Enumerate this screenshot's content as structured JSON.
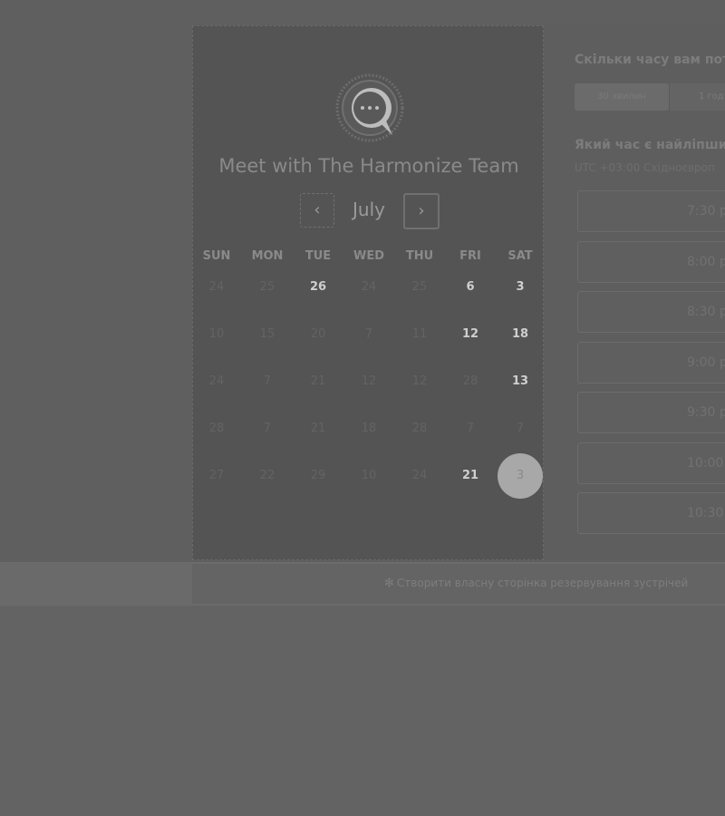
{
  "calendar": {
    "title": "Meet with The Harmonize Team",
    "month": "July",
    "prev_label": "‹",
    "next_label": "›",
    "weekdays": [
      "SUN",
      "MON",
      "TUE",
      "WED",
      "THU",
      "FRI",
      "SAT"
    ],
    "weeks": [
      [
        {
          "d": "24",
          "a": false
        },
        {
          "d": "25",
          "a": false
        },
        {
          "d": "26",
          "a": true
        },
        {
          "d": "24",
          "a": false
        },
        {
          "d": "25",
          "a": false
        },
        {
          "d": "6",
          "a": true
        },
        {
          "d": "3",
          "a": true
        }
      ],
      [
        {
          "d": "10",
          "a": false
        },
        {
          "d": "15",
          "a": false
        },
        {
          "d": "20",
          "a": false
        },
        {
          "d": "7",
          "a": false
        },
        {
          "d": "11",
          "a": false
        },
        {
          "d": "12",
          "a": true
        },
        {
          "d": "18",
          "a": true
        }
      ],
      [
        {
          "d": "24",
          "a": false
        },
        {
          "d": "7",
          "a": false
        },
        {
          "d": "21",
          "a": false
        },
        {
          "d": "12",
          "a": false
        },
        {
          "d": "12",
          "a": false
        },
        {
          "d": "28",
          "a": false
        },
        {
          "d": "13",
          "a": true
        }
      ],
      [
        {
          "d": "28",
          "a": false
        },
        {
          "d": "7",
          "a": false
        },
        {
          "d": "21",
          "a": false
        },
        {
          "d": "18",
          "a": false
        },
        {
          "d": "28",
          "a": false
        },
        {
          "d": "7",
          "a": false
        },
        {
          "d": "7",
          "a": false
        }
      ],
      [
        {
          "d": "27",
          "a": false
        },
        {
          "d": "22",
          "a": false
        },
        {
          "d": "29",
          "a": false
        },
        {
          "d": "10",
          "a": false
        },
        {
          "d": "24",
          "a": false
        },
        {
          "d": "21",
          "a": true
        },
        {
          "d": "3",
          "a": false,
          "selected": true
        }
      ]
    ]
  },
  "booking": {
    "duration_question": "Скільки часу вам пот",
    "duration_options": [
      "30 хвилин",
      "1 год"
    ],
    "time_question": "Який час є найліпшим",
    "timezone": "UTC +03:00 Східноєвроп",
    "slots": [
      "7:30 p",
      "8:00 p",
      "8:30 p",
      "9:00 p",
      "9:30 p",
      "10:00",
      "10:30"
    ]
  },
  "footer": {
    "link_text": "Створити власну сторінка резервування зустрічей"
  },
  "icons": {
    "logo": "chat-bubble-logo-icon",
    "footer": "sprocket-icon"
  }
}
